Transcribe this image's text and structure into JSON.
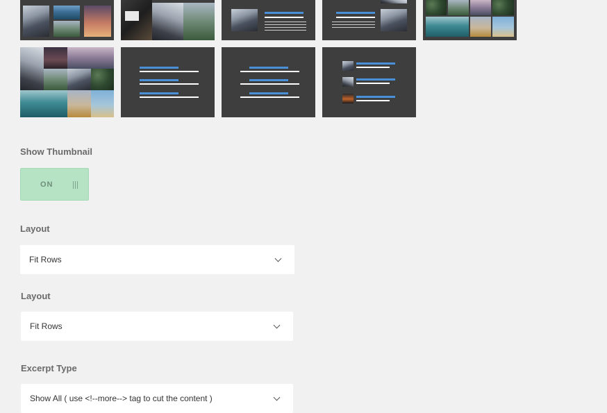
{
  "show_thumbnail": {
    "label": "Show Thumbnail",
    "toggle_text": "ON",
    "state": "on"
  },
  "layout_1": {
    "label": "Layout",
    "value": "Fit Rows"
  },
  "layout_2": {
    "label": "Layout",
    "value": "Fit Rows"
  },
  "excerpt": {
    "label": "Excerpt Type",
    "value": "Show All ( use <!--more--> tag to cut the content )"
  },
  "colors": {
    "page_bg": "#f1f1f1",
    "thumb_bg": "#3e3e3e",
    "accent_blue": "#4a90d9",
    "toggle_on": "#b6e3c4"
  },
  "icons": {
    "select_arrow": "chevron-down-icon",
    "toggle_handle": "grip-icon"
  }
}
